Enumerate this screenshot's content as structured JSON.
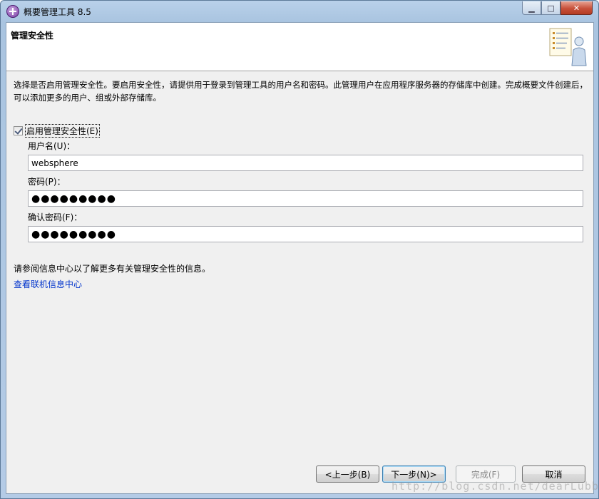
{
  "window": {
    "title": "概要管理工具 8.5",
    "controls": {
      "minimize": "▁",
      "maximize": "□",
      "close": "✕"
    }
  },
  "banner": {
    "title": "管理安全性",
    "illustration": "wizard-person-icon"
  },
  "description": "选择是否启用管理安全性。要启用安全性，请提供用于登录到管理工具的用户名和密码。此管理用户在应用程序服务器的存储库中创建。完成概要文件创建后，可以添加更多的用户、组或外部存储库。",
  "security": {
    "enable_label": "启用管理安全性(E)",
    "enabled": true,
    "username_label": "用户名(U)：",
    "username_value": "websphere",
    "password_label": "密码(P)：",
    "password_value": "●●●●●●●●●",
    "confirm_label": "确认密码(F)：",
    "confirm_value": "●●●●●●●●●"
  },
  "info": {
    "text": "请参阅信息中心以了解更多有关管理安全性的信息。",
    "link": "查看联机信息中心"
  },
  "buttons": {
    "back": "<上一步(B)",
    "next": "下一步(N)>",
    "finish": "完成(F)",
    "cancel": "取消"
  },
  "watermark": "http://blog.csdn.net/dearLubb"
}
